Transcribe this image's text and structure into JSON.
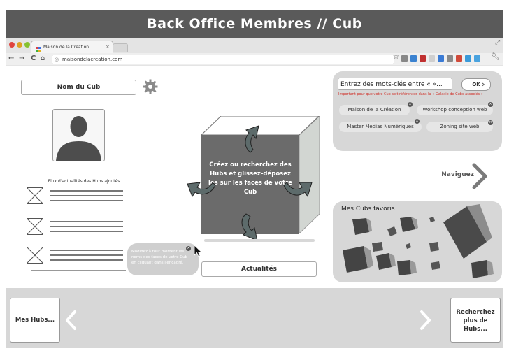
{
  "banner": {
    "title": "Back Office Membres // Cub"
  },
  "browser": {
    "tab_title": "Maison de la Création",
    "tab_close": "×",
    "url": "maisondelacreation.com",
    "nav": {
      "back": "←",
      "forward": "→",
      "reload": "C"
    }
  },
  "left": {
    "cub_name": "Nom du Cub",
    "feed_title": "Flux d'actualités des Hubs ajoutés",
    "tooltip": "Modifiez à tout moment les noms des faces de votre Cub en cliquant dans l'encadré."
  },
  "center": {
    "cube_text": "Créez ou recherchez des Hubs et glissez-déposez les sur les faces de votre Cub",
    "news_button": "Actualités"
  },
  "search": {
    "placeholder": "Entrez des mots-clés entre « »...",
    "ok_label": "OK",
    "hint": "Important pour que votre Cub soit référencer dans la « Galaxie de Cubs associés »",
    "tags": [
      "Maison de la Création",
      "Workshop conception web",
      "Master Médias Numériques",
      "Zoning site web"
    ]
  },
  "navigate": {
    "label": "Naviguez"
  },
  "favorites": {
    "title": "Mes Cubs favoris"
  },
  "bottom": {
    "my_hubs": "Mes Hubs...",
    "more_hubs": "Recherchez plus de Hubs...",
    "prev": "‹",
    "next": "›"
  },
  "colors": {
    "banner": "#5a5a5a",
    "panel": "#d7d7d7",
    "cube": "#6b6b6b",
    "accent_red": "#d0342c"
  }
}
